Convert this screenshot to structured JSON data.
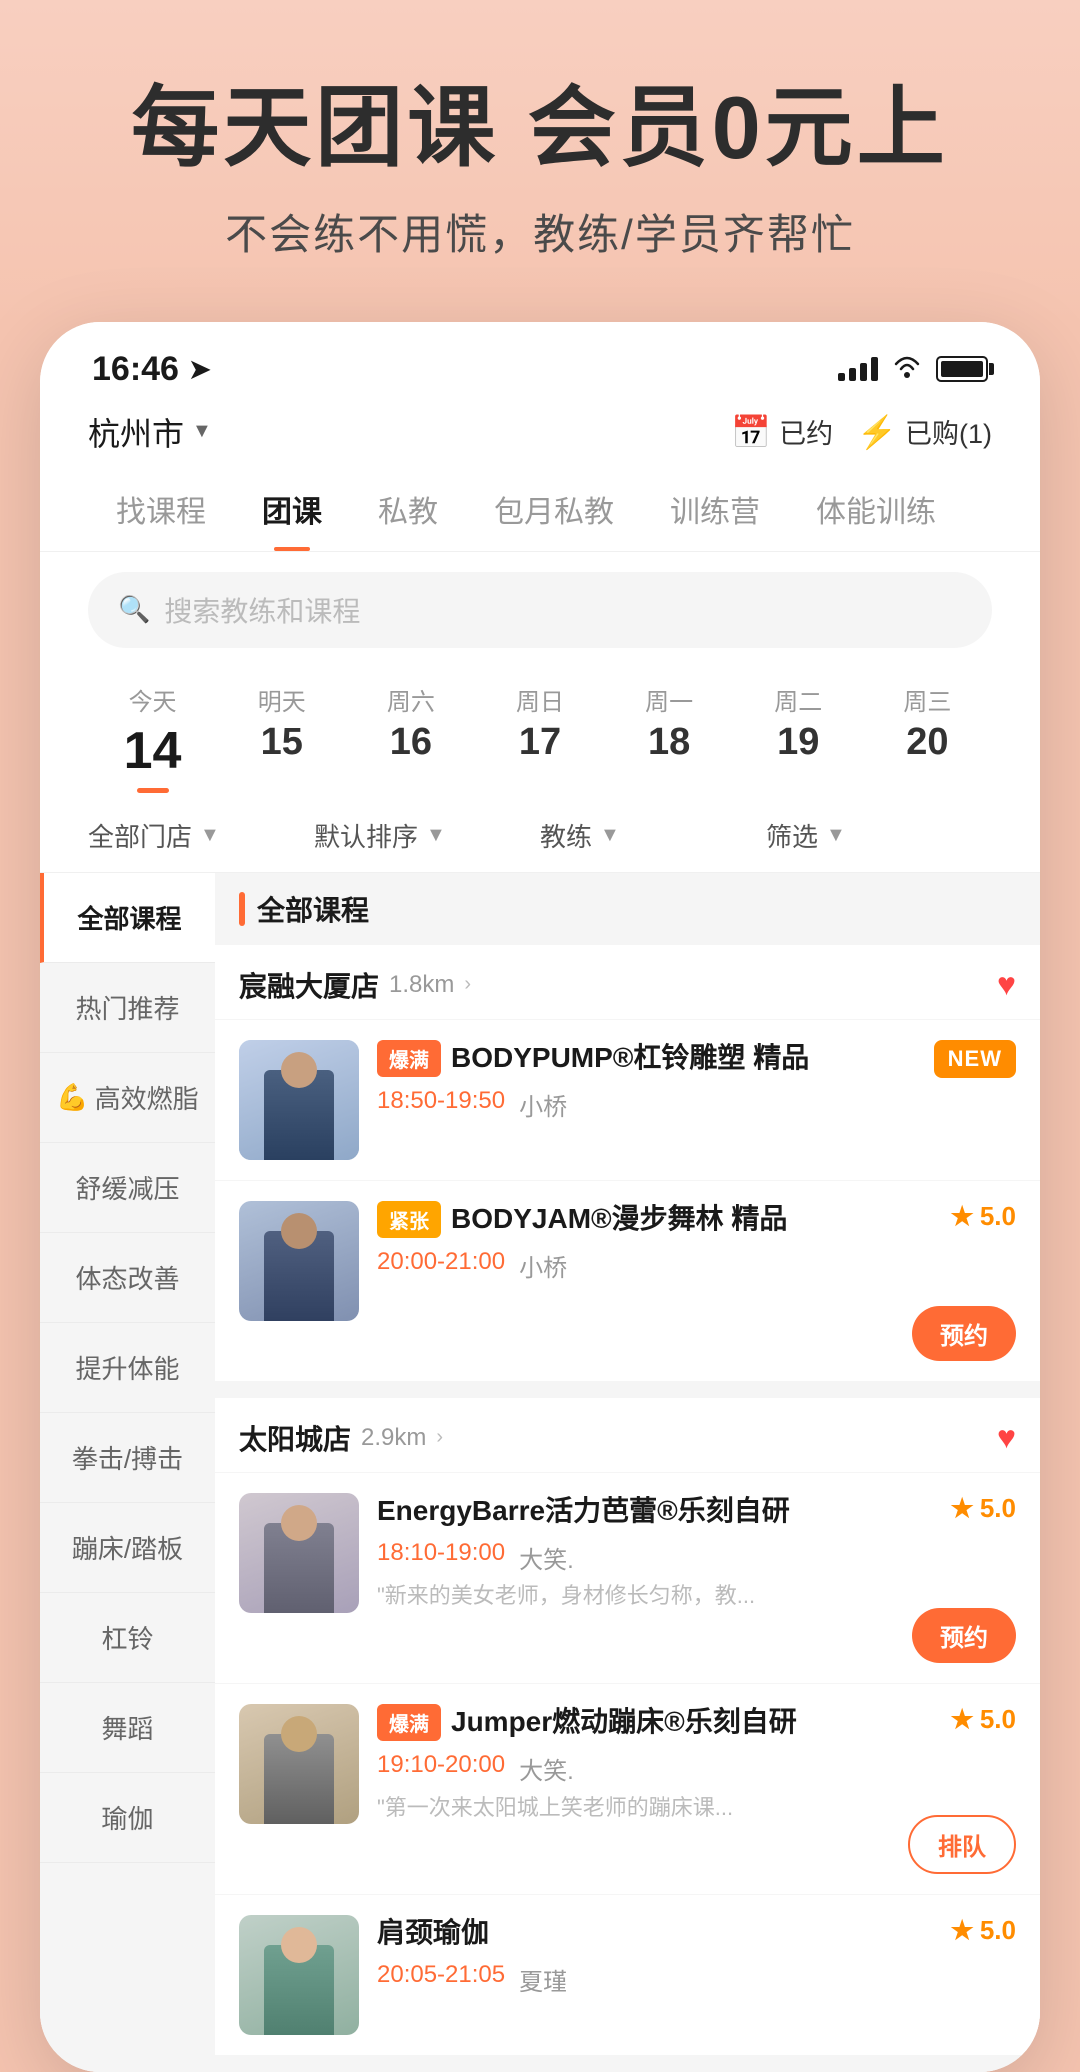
{
  "hero": {
    "title": "每天团课 会员0元上",
    "subtitle": "不会练不用慌，教练/学员齐帮忙"
  },
  "statusBar": {
    "time": "16:46",
    "navIcon": "🧭"
  },
  "header": {
    "location": "杭州市",
    "booked_label": "已约",
    "purchased_label": "已购(1)"
  },
  "navTabs": [
    {
      "label": "找课程",
      "active": false
    },
    {
      "label": "团课",
      "active": true
    },
    {
      "label": "私教",
      "active": false
    },
    {
      "label": "包月私教",
      "active": false
    },
    {
      "label": "训练营",
      "active": false
    },
    {
      "label": "体能训练",
      "active": false
    }
  ],
  "search": {
    "placeholder": "搜索教练和课程"
  },
  "dates": [
    {
      "label": "今天",
      "num": "14",
      "today": true
    },
    {
      "label": "明天",
      "num": "15",
      "today": false
    },
    {
      "label": "周六",
      "num": "16",
      "today": false
    },
    {
      "label": "周日",
      "num": "17",
      "today": false
    },
    {
      "label": "周一",
      "num": "18",
      "today": false
    },
    {
      "label": "周二",
      "num": "19",
      "today": false
    },
    {
      "label": "周三",
      "num": "20",
      "today": false
    }
  ],
  "filters": [
    {
      "label": "全部门店"
    },
    {
      "label": "默认排序"
    },
    {
      "label": "教练"
    },
    {
      "label": "筛选"
    }
  ],
  "sidebar": {
    "items": [
      {
        "label": "全部课程",
        "active": true,
        "emoji": ""
      },
      {
        "label": "热门推荐",
        "active": false,
        "emoji": ""
      },
      {
        "label": "高效燃脂",
        "active": false,
        "emoji": "💪"
      },
      {
        "label": "舒缓减压",
        "active": false,
        "emoji": ""
      },
      {
        "label": "体态改善",
        "active": false,
        "emoji": ""
      },
      {
        "label": "提升体能",
        "active": false,
        "emoji": ""
      },
      {
        "label": "拳击/搏击",
        "active": false,
        "emoji": ""
      },
      {
        "label": "蹦床/踏板",
        "active": false,
        "emoji": ""
      },
      {
        "label": "杠铃",
        "active": false,
        "emoji": ""
      },
      {
        "label": "舞蹈",
        "active": false,
        "emoji": ""
      },
      {
        "label": "瑜伽",
        "active": false,
        "emoji": ""
      }
    ]
  },
  "gyms": [
    {
      "name": "宸融大厦店",
      "distance": "1.8km",
      "favorited": true,
      "courses": [
        {
          "badge": "爆满",
          "badge_type": "hot",
          "name": "BODYPUMP®杠铃雕塑 精品",
          "time": "18:50-19:50",
          "trainer": "小桥",
          "rating": null,
          "new_tag": "NEW",
          "book_btn": null,
          "desc": null
        },
        {
          "badge": "紧张",
          "badge_type": "tight",
          "name": "BODYJAM®漫步舞林 精品",
          "time": "20:00-21:00",
          "trainer": "小桥",
          "rating": "5.0",
          "new_tag": null,
          "book_btn": "预约",
          "desc": null
        }
      ]
    },
    {
      "name": "太阳城店",
      "distance": "2.9km",
      "favorited": true,
      "courses": [
        {
          "badge": null,
          "badge_type": null,
          "name": "EnergyBarre活力芭蕾®乐刻自研",
          "time": "18:10-19:00",
          "trainer": "大笑.",
          "rating": "5.0",
          "new_tag": null,
          "book_btn": "预约",
          "desc": "\"新来的美女老师，身材修长匀称，教..."
        },
        {
          "badge": "爆满",
          "badge_type": "hot",
          "name": "Jumper燃动蹦床®乐刻自研",
          "time": "19:10-20:00",
          "trainer": "大笑.",
          "rating": "5.0",
          "new_tag": null,
          "book_btn": "排队",
          "book_btn_outline": true,
          "desc": "\"第一次来太阳城上笑老师的蹦床课..."
        },
        {
          "badge": null,
          "badge_type": null,
          "name": "肩颈瑜伽",
          "time": "20:05-21:05",
          "trainer": "夏瑾",
          "rating": "5.0",
          "new_tag": null,
          "book_btn": null,
          "desc": null
        }
      ]
    }
  ]
}
